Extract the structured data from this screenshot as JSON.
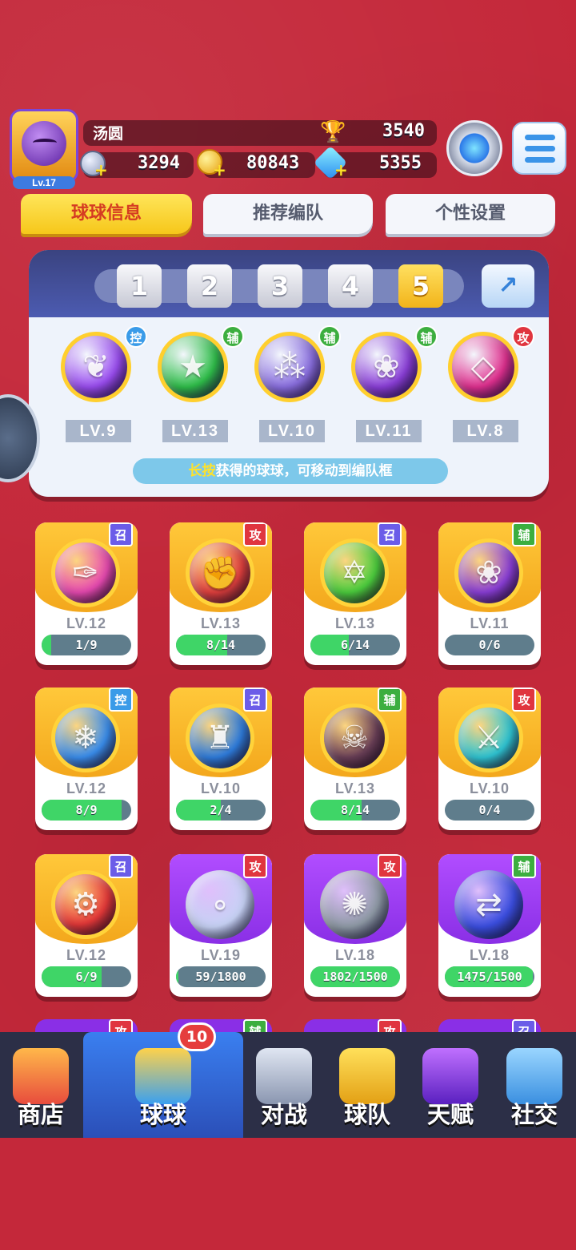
{
  "header": {
    "player_name": "汤圆",
    "avatar_level": "Lv.17",
    "trophy_icon": "trophy-icon",
    "trophies": "3540",
    "resources": [
      {
        "icon": "silver-coin-icon",
        "value": "3294"
      },
      {
        "icon": "gold-coin-icon",
        "value": "80843"
      },
      {
        "icon": "diamond-icon",
        "value": "5355"
      }
    ],
    "plus": "+"
  },
  "tabs": [
    "球球信息",
    "推荐编队",
    "个性设置"
  ],
  "team": {
    "slots": [
      "1",
      "2",
      "3",
      "4",
      "5"
    ],
    "selected_slot": "5",
    "share_icon": "↗",
    "members": [
      {
        "tag": "控",
        "level": "LV.9",
        "color": "#9a4df0",
        "glyph": "❦"
      },
      {
        "tag": "辅",
        "level": "LV.13",
        "color": "#2fbf4a",
        "glyph": "★"
      },
      {
        "tag": "辅",
        "level": "LV.10",
        "color": "#8a6fe0",
        "glyph": "⁂"
      },
      {
        "tag": "辅",
        "level": "LV.11",
        "color": "#8b3fd9",
        "glyph": "❀"
      },
      {
        "tag": "攻",
        "level": "LV.8",
        "color": "#e0308f",
        "glyph": "◇"
      }
    ],
    "hint_highlight": "长按",
    "hint_rest": "获得的球球，可移动到编队框"
  },
  "cards": [
    {
      "tag": "召",
      "level": "LV.12",
      "progress": "1/9",
      "fill": 0.11,
      "color": "#e84ab2",
      "glyph": "✑",
      "style": "gold"
    },
    {
      "tag": "攻",
      "level": "LV.13",
      "progress": "8/14",
      "fill": 0.57,
      "color": "#e2403e",
      "glyph": "✊",
      "style": "gold"
    },
    {
      "tag": "召",
      "level": "LV.13",
      "progress": "6/14",
      "fill": 0.43,
      "color": "#4ccf3e",
      "glyph": "✡",
      "style": "gold"
    },
    {
      "tag": "辅",
      "level": "LV.11",
      "progress": "0/6",
      "fill": 0,
      "color": "#8b3fd9",
      "glyph": "❀",
      "style": "gold"
    },
    {
      "tag": "控",
      "level": "LV.12",
      "progress": "8/9",
      "fill": 0.89,
      "color": "#3a8ff0",
      "glyph": "❄",
      "style": "gold"
    },
    {
      "tag": "召",
      "level": "LV.10",
      "progress": "2/4",
      "fill": 0.5,
      "color": "#2f7ee0",
      "glyph": "♜",
      "style": "gold"
    },
    {
      "tag": "辅",
      "level": "LV.13",
      "progress": "8/14",
      "fill": 0.57,
      "color": "#6b4058",
      "glyph": "☠",
      "style": "gold"
    },
    {
      "tag": "攻",
      "level": "LV.10",
      "progress": "0/4",
      "fill": 0,
      "color": "#2fc7d6",
      "glyph": "⚔",
      "style": "gold"
    },
    {
      "tag": "召",
      "level": "LV.12",
      "progress": "6/9",
      "fill": 0.67,
      "color": "#e83a3a",
      "glyph": "⚙",
      "style": "gold"
    },
    {
      "tag": "攻",
      "level": "LV.19",
      "progress": "59/1800",
      "fill": 0.03,
      "color": "#c7d2f5",
      "glyph": "∘",
      "style": "purple"
    },
    {
      "tag": "攻",
      "level": "LV.18",
      "progress": "1802/1500",
      "fill": 1,
      "color": "#8f9aa6",
      "glyph": "✺",
      "style": "purple"
    },
    {
      "tag": "辅",
      "level": "LV.18",
      "progress": "1475/1500",
      "fill": 0.98,
      "color": "#3b4ee0",
      "glyph": "⇄",
      "style": "purple"
    }
  ],
  "peek_tags": [
    "攻",
    "辅",
    "攻",
    "召"
  ],
  "nav": {
    "items": [
      {
        "label": "商店",
        "icon": "shop-icon"
      },
      {
        "label": "球球",
        "icon": "balls-icon"
      },
      {
        "label": "对战",
        "icon": "crossed-swords-icon"
      },
      {
        "label": "球队",
        "icon": "whistle-icon"
      },
      {
        "label": "天赋",
        "icon": "planet-icon"
      },
      {
        "label": "社交",
        "icon": "chat-icon"
      }
    ],
    "active": "球球",
    "badge": "10"
  },
  "colors": {
    "accent": "#f6c71a",
    "background": "#c4283a",
    "progress": "#3fd567"
  }
}
